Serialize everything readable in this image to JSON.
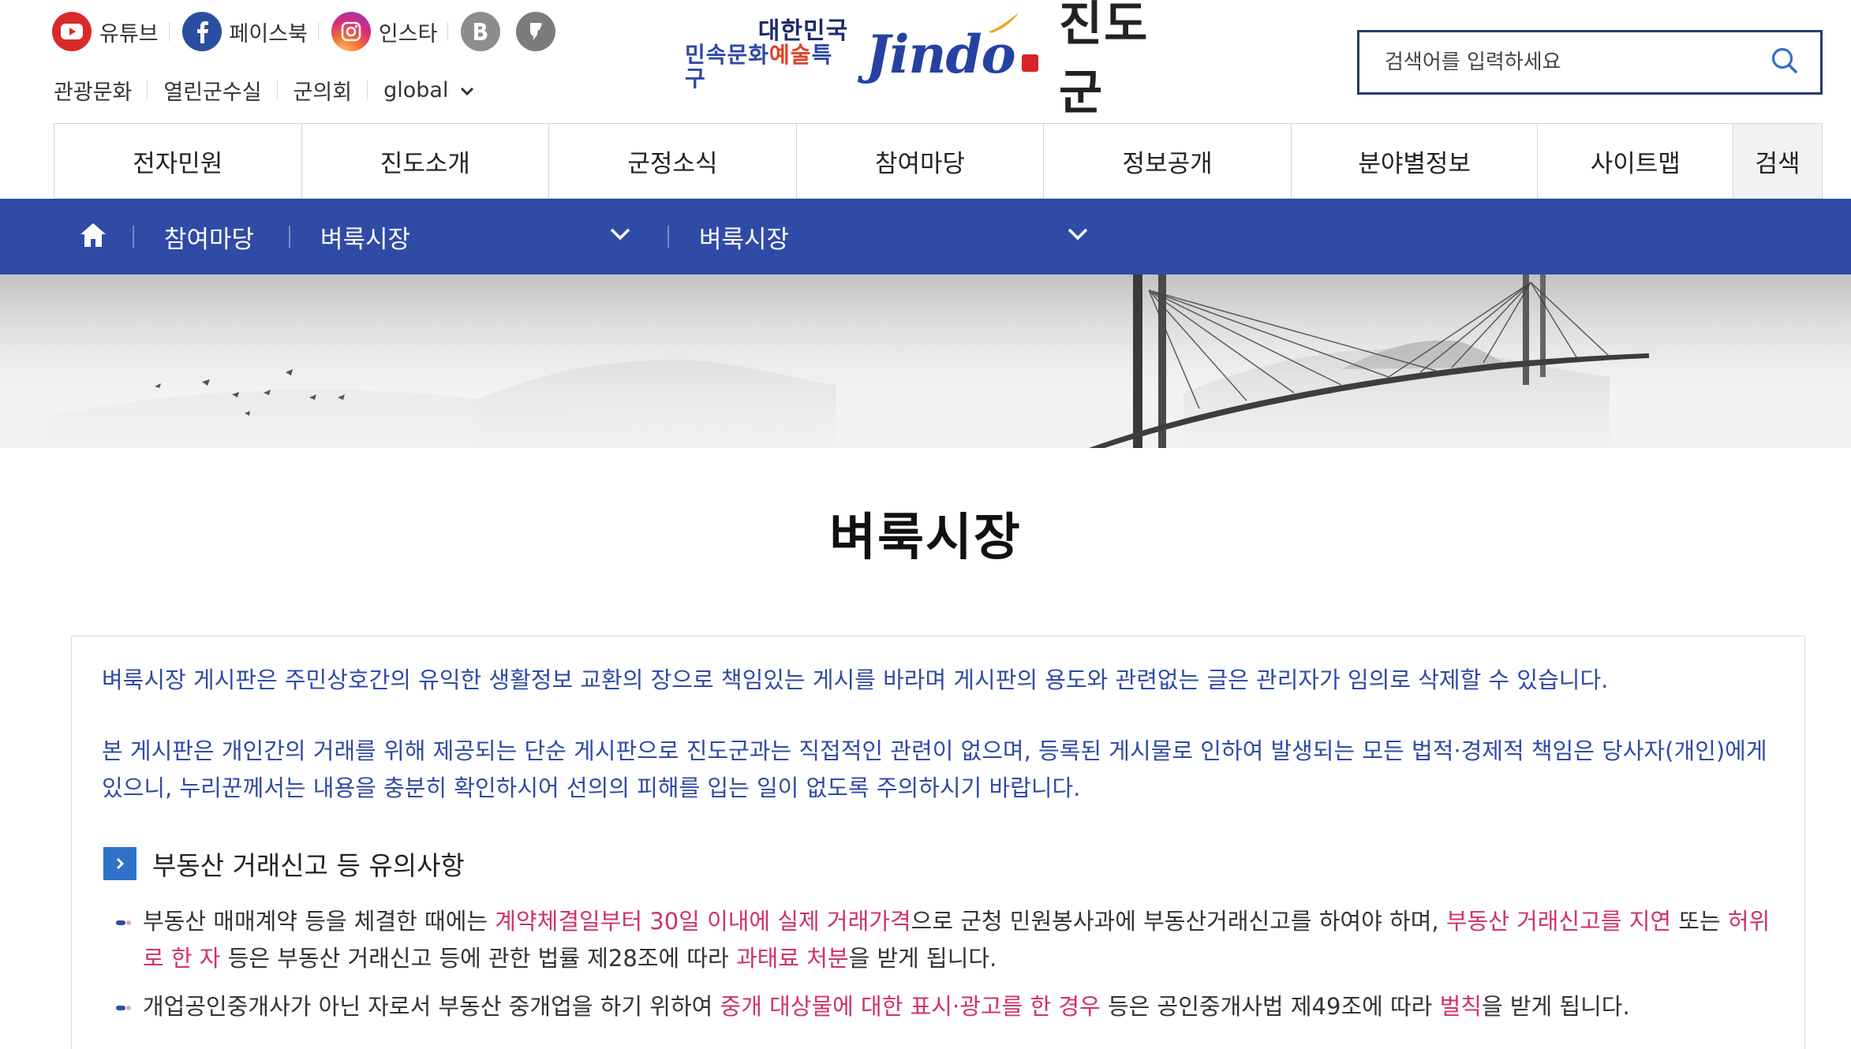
{
  "sns": {
    "youtube": "유튜브",
    "facebook": "페이스북",
    "instagram": "인스타"
  },
  "quick_links": [
    "관광문화",
    "열린군수실",
    "군의회",
    "global"
  ],
  "logo": {
    "slogan_top": "대한민국",
    "slogan_bottom_a": "민속문화",
    "slogan_bottom_b": "예술",
    "slogan_bottom_c": "특구",
    "mark": "Jindo",
    "name": "진도군"
  },
  "search": {
    "placeholder": "검색어를 입력하세요"
  },
  "gnb": [
    "전자민원",
    "진도소개",
    "군정소식",
    "참여마당",
    "정보공개",
    "분야별정보",
    "사이트맵",
    "검색"
  ],
  "location": {
    "depth1": "참여마당",
    "depth2": "벼룩시장",
    "depth3": "벼룩시장"
  },
  "page_title": "벼룩시장",
  "notice": {
    "p1": "벼룩시장 게시판은 주민상호간의 유익한 생활정보 교환의 장으로 책임있는 게시를 바라며 게시판의 용도와 관련없는 글은 관리자가 임의로 삭제할 수 있습니다.",
    "p2": "본 게시판은 개인간의 거래를 위해 제공되는 단순 게시판으로 진도군과는 직접적인 관련이 없으며, 등록된 게시물로 인하여 발생되는 모든 법적·경제적 책임은 당사자(개인)에게 있으니, 누리꾼께서는 내용을 충분히 확인하시어 선의의 피해를 입는 일이 없도록 주의하시기 바랍니다.",
    "section_title": "부동산 거래신고 등 유의사항",
    "b1": {
      "t1": "부동산 매매계약 등을 체결한 때에는 ",
      "h1": "계약체결일부터 30일 이내에 실제 거래가격",
      "t2": "으로 군청 민원봉사과에 부동산거래신고를 하여야 하며, ",
      "h2": "부동산 거래신고를 지연",
      "t3": " 또는 ",
      "h3": "허위로 한 자",
      "t4": " 등은 부동산 거래신고 등에 관한 법률 제28조에 따라 ",
      "h4": "과태료 처분",
      "t5": "을 받게 됩니다."
    },
    "b2": {
      "t1": "개업공인중개사가 아닌 자로서 부동산 중개업을 하기 위하여 ",
      "h1": "중개 대상물에 대한 표시·광고를 한 경우",
      "t2": " 등은 공인중개사법 제49조에 따라 ",
      "h2": "벌칙",
      "t3": "을 받게 됩니다."
    }
  }
}
